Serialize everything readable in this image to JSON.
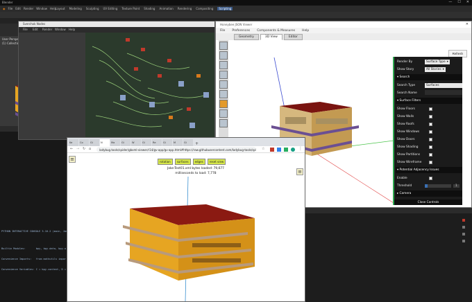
{
  "blender": {
    "title": "Blender",
    "menu": [
      "File",
      "Edit",
      "Render",
      "Window",
      "Help"
    ],
    "workspaces": [
      "Layout",
      "Modeling",
      "Sculpting",
      "UV Editing",
      "Texture Paint",
      "Shading",
      "Animation",
      "Rendering",
      "Compositing",
      "Scripting"
    ],
    "active_workspace": "Scripting",
    "window_controls": [
      "—",
      "☐",
      "✕"
    ],
    "viewport": {
      "perspective_label": "User Perspective",
      "collection_label": "(1) Collection"
    },
    "console_lines": [
      "PYTHON INTERACTIVE CONSOLE 3.10.2 (main, Jan",
      "",
      "Builtin Modules:       bpy, bpy.data, bpy.o",
      "Convenience Imports:   from mathutils impor",
      "Convenience Variables: C = bpy.context, D ="
    ]
  },
  "node_window": {
    "title": "Sverchok Nodes",
    "menu": [
      "File",
      "Edit",
      "Render",
      "Window",
      "Help"
    ]
  },
  "lb_window": {
    "title": "Honeybee JSON Viewer",
    "menu": [
      "File",
      "Preferences",
      "Components & Measures",
      "Help"
    ],
    "tabs": [
      "Geometry",
      "3D View",
      "Editor"
    ],
    "active_tab": "3D View",
    "refresh": "Refresh",
    "controls": {
      "render_by_label": "Render By",
      "render_by_value": "Surface Type",
      "show_story_label": "Show Story",
      "show_story_value": "All Stories",
      "search_section": "Search",
      "search_type_label": "Search Type",
      "search_type_value": "Surfaces",
      "search_name_label": "Search Name",
      "surface_filters_section": "Surface Filters",
      "filters": [
        "Show Floors",
        "Show Walls",
        "Show Roofs",
        "Show Windows",
        "Show Doors",
        "Show Shading",
        "Show Partitions",
        "Show Wireframe"
      ],
      "adjacency_section": "Potential Adjacency Issues",
      "enable_label": "Enable",
      "threshold_label": "Threshold",
      "threshold_value": "1",
      "camera_section": "Camera",
      "close_controls": "Close Controls"
    }
  },
  "browser": {
    "tabs": [
      "Ke",
      "Co",
      "Gi",
      "N",
      "Ma",
      "Gi",
      "W",
      "Gi",
      "Re",
      "Gi",
      "M",
      "Gi"
    ],
    "url": "ladybug.tools/spider/gbxml-viewer/r14/gv-app/gv-app.html#https://raw.githubusercontent.com/ladybug-tools/spi",
    "buttons": [
      "rotation",
      "surfaces",
      "edges",
      "reset view"
    ],
    "info_line1": "Jake-Test01.xml bytes loaded: 79,677",
    "info_line2": "milliseconds to load: 7,778"
  },
  "colors": {
    "roof": "#8b1a12",
    "walls": "#e0a21e",
    "floors": "#c7a07a",
    "shading": "#7a6aa0",
    "accent_green": "#2fa84f"
  }
}
